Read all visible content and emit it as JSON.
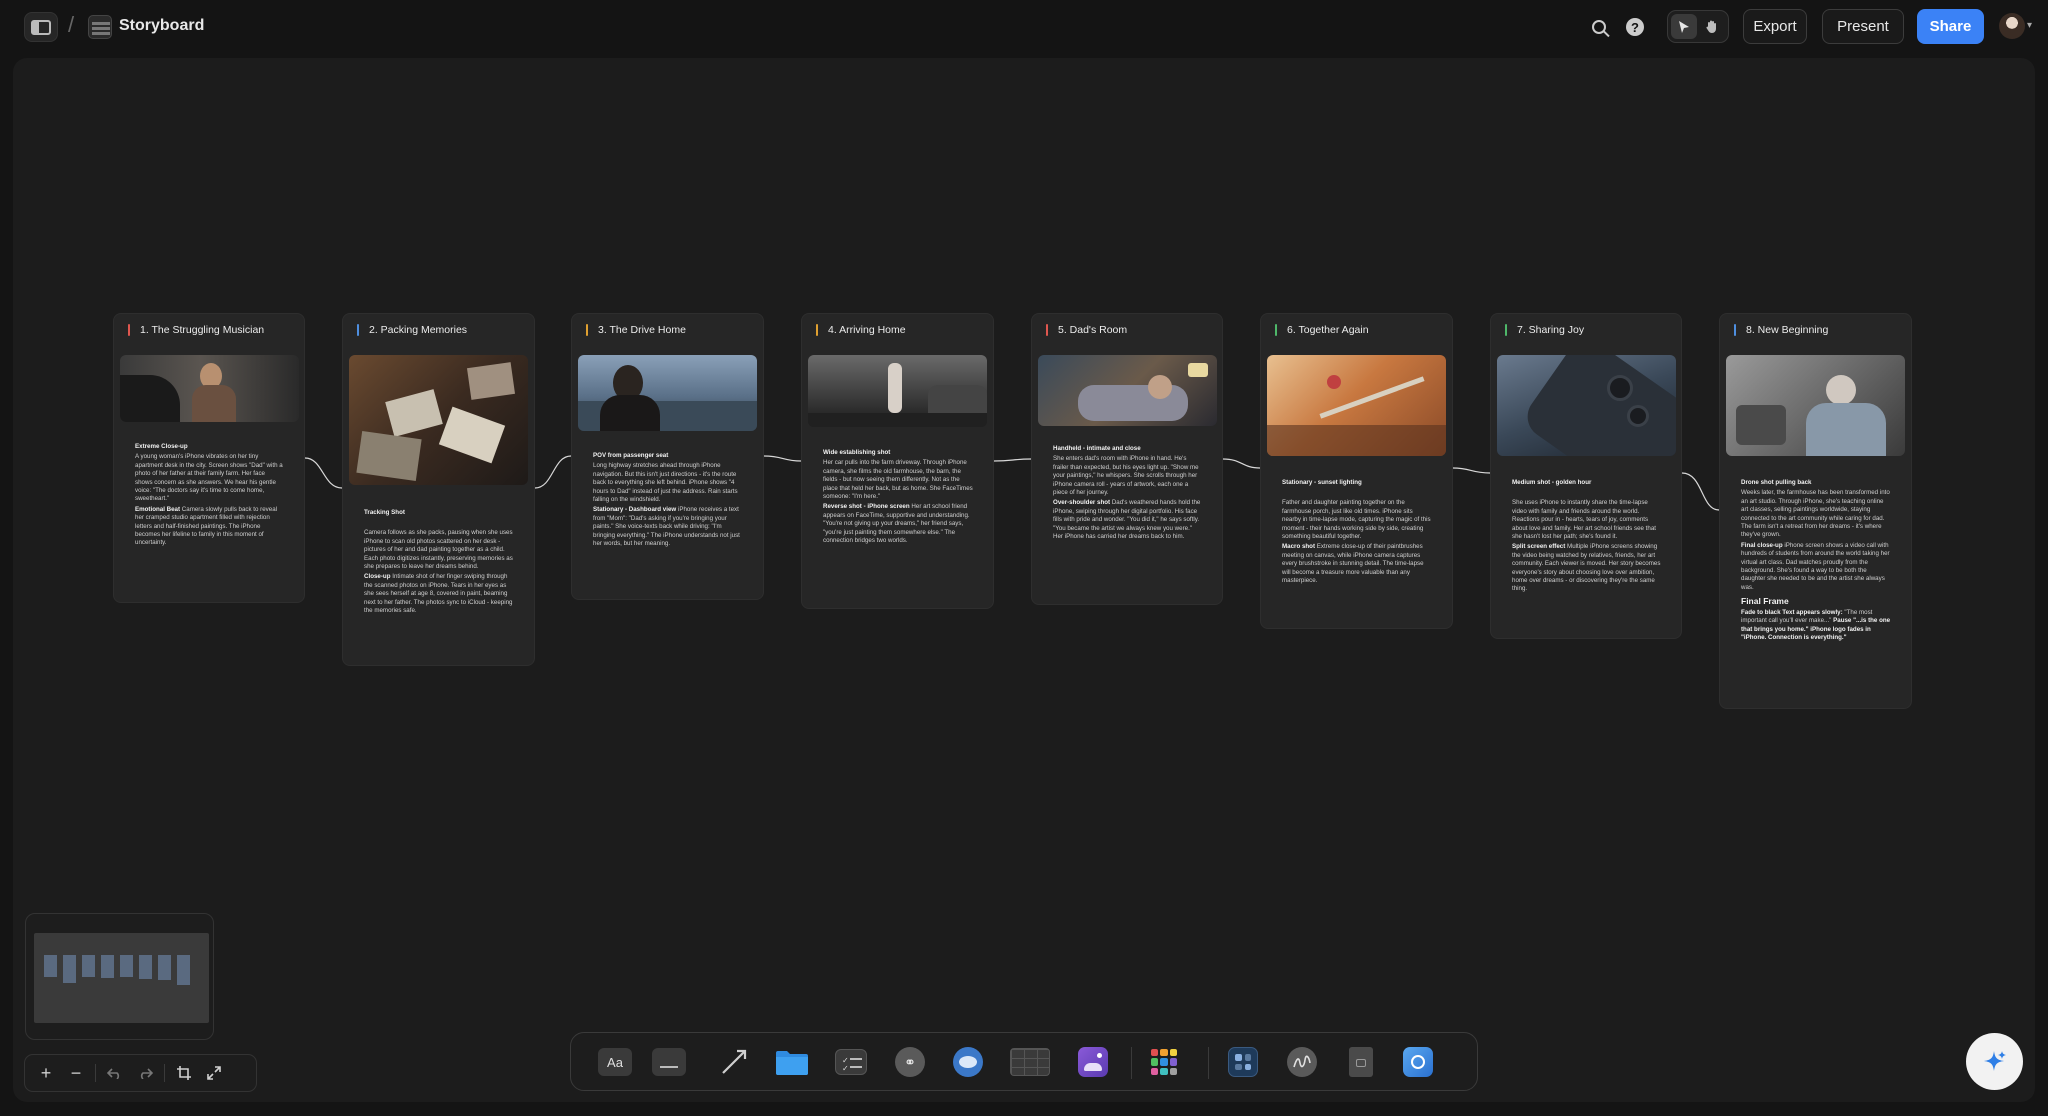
{
  "app": {
    "title": "Storyboard"
  },
  "header": {
    "export_label": "Export",
    "present_label": "Present",
    "share_label": "Share",
    "help_glyph": "?"
  },
  "colors": {
    "accent": "#3b82f6",
    "canvas": "#1c1c1c",
    "card": "#262626"
  },
  "scenes": [
    {
      "title": "1. The Struggling Musician",
      "accent": "#e0574f",
      "blocks": [
        {
          "heading": "Extreme Close-up",
          "text": "A young woman's iPhone vibrates on her tiny apartment desk in the city. Screen shows \"Dad\" with a photo of her father at their family farm. Her face shows concern as she answers. We hear his gentle voice: \"The doctors say it's time to come home, sweetheart.\""
        },
        {
          "heading": "Emotional Beat",
          "text": "Camera slowly pulls back to reveal her cramped studio apartment filled with rejection letters and half-finished paintings. The iPhone becomes her lifeline to family in this moment of uncertainty."
        }
      ]
    },
    {
      "title": "2. Packing Memories",
      "accent": "#4e8fe0",
      "blocks": [
        {
          "heading": "Tracking Shot",
          "text": "Camera follows as she packs, pausing when she uses iPhone to scan old photos scattered on her desk - pictures of her and dad painting together as a child. Each photo digitizes instantly, preserving memories as she prepares to leave her dreams behind."
        },
        {
          "heading": "Close-up",
          "text": "Intimate shot of her finger swiping through the scanned photos on iPhone. Tears in her eyes as she sees herself at age 8, covered in paint, beaming next to her father. The photos sync to iCloud - keeping the memories safe."
        }
      ]
    },
    {
      "title": "3. The Drive Home",
      "accent": "#e0a030",
      "blocks": [
        {
          "heading": "POV from passenger seat",
          "text": "Long highway stretches ahead through iPhone navigation. But this isn't just directions - it's the route back to everything she left behind. iPhone shows \"4 hours to Dad\" instead of just the address. Rain starts falling on the windshield."
        },
        {
          "heading": "Stationary - Dashboard view",
          "text": "iPhone receives a text from \"Mom\": \"Dad's asking if you're bringing your paints.\" She voice-texts back while driving: \"I'm bringing everything.\" The iPhone understands not just her words, but her meaning."
        }
      ]
    },
    {
      "title": "4. Arriving Home",
      "accent": "#e0a030",
      "blocks": [
        {
          "heading": "Wide establishing shot",
          "text": "Her car pulls into the farm driveway. Through iPhone camera, she films the old farmhouse, the barn, the fields - but now seeing them differently. Not as the place that held her back, but as home. She FaceTimes someone: \"I'm here.\""
        },
        {
          "heading": "Reverse shot - iPhone screen",
          "text": "Her art school friend appears on FaceTime, supportive and understanding. \"You're not giving up your dreams,\" her friend says, \"you're just painting them somewhere else.\" The connection bridges two worlds."
        }
      ]
    },
    {
      "title": "5. Dad's Room",
      "accent": "#e0574f",
      "blocks": [
        {
          "heading": "Handheld - intimate and close",
          "text": "She enters dad's room with iPhone in hand. He's frailer than expected, but his eyes light up. \"Show me your paintings,\" he whispers. She scrolls through her iPhone camera roll - years of artwork, each one a piece of her journey."
        },
        {
          "heading": "Over-shoulder shot",
          "text": "Dad's weathered hands hold the iPhone, swiping through her digital portfolio. His face fills with pride and wonder. \"You did it,\" he says softly. \"You became the artist we always knew you were.\" Her iPhone has carried her dreams back to him."
        }
      ]
    },
    {
      "title": "6. Together Again",
      "accent": "#4fb86a",
      "blocks": [
        {
          "heading": "Stationary - sunset lighting",
          "text": "Father and daughter painting together on the farmhouse porch, just like old times. iPhone sits nearby in time-lapse mode, capturing the magic of this moment - their hands working side by side, creating something beautiful together."
        },
        {
          "heading": "Macro shot",
          "text": "Extreme close-up of their paintbrushes meeting on canvas, while iPhone camera captures every brushstroke in stunning detail. The time-lapse will become a treasure more valuable than any masterpiece."
        }
      ]
    },
    {
      "title": "7. Sharing Joy",
      "accent": "#4fb86a",
      "blocks": [
        {
          "heading": "Medium shot - golden hour",
          "text": "She uses iPhone to instantly share the time-lapse video with family and friends around the world. Reactions pour in - hearts, tears of joy, comments about love and family. Her art school friends see that she hasn't lost her path; she's found it."
        },
        {
          "heading": "Split screen effect",
          "text": "Multiple iPhone screens showing the video being watched by relatives, friends, her art community. Each viewer is moved. Her story becomes everyone's story about choosing love over ambition, home over dreams - or discovering they're the same thing."
        }
      ]
    },
    {
      "title": "8. New Beginning",
      "accent": "#4e8fe0",
      "blocks": [
        {
          "heading": "Drone shot pulling back",
          "text": "Weeks later, the farmhouse has been transformed into an art studio. Through iPhone, she's teaching online art classes, selling paintings worldwide, staying connected to the art community while caring for dad. The farm isn't a retreat from her dreams - it's where they've grown."
        },
        {
          "heading": "Final close-up",
          "text": "iPhone screen shows a video call with hundreds of students from around the world taking her virtual art class. Dad watches proudly from the background. She's found a way to be both the daughter she needed to be and the artist she always was."
        }
      ],
      "final_frame": {
        "heading": "Final Frame",
        "label": "Fade to black Text appears slowly:",
        "quote": "\"The most important call you'll ever make...\"",
        "pause": "Pause",
        "tagline": "\"...is the one that brings you home.\"",
        "logo_line": "iPhone logo fades in",
        "closing": "\"iPhone. Connection is everything.\""
      }
    }
  ],
  "toolbar": {
    "tools": [
      "text-tool",
      "sticky-tool",
      "arrow-tool",
      "folder-tool",
      "checklist-tool",
      "link-tool",
      "comment-tool",
      "table-tool",
      "image-tool",
      "apps-tool",
      "widget-tool",
      "sketch-tool",
      "file-tool",
      "assistant-tool"
    ],
    "text_tool_label": "Aa"
  },
  "zoom": {
    "plus": "+",
    "minus": "−"
  }
}
